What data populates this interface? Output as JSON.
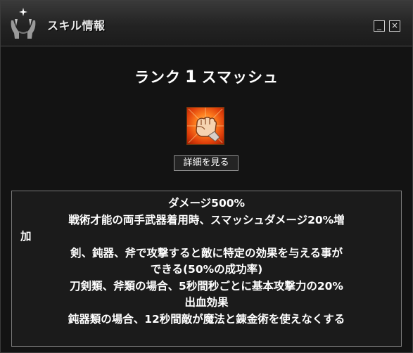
{
  "window": {
    "title": "スキル情報",
    "minimize_label": "_",
    "close_label": "×"
  },
  "skill": {
    "rank_prefix": "ランク",
    "rank_number": "1",
    "name": "スマッシュ",
    "icon": "fist-icon",
    "detail_button_label": "詳細を見る"
  },
  "description": {
    "lines": [
      "ダメージ500%",
      "戦術才能の両手武器着用時、スマッシュダメージ20%増",
      "加",
      "剣、鈍器、斧で攻撃すると敵に特定の効果を与える事が",
      "できる(50%の成功率)",
      "刀剣類、斧類の場合、5秒間秒ごとに基本攻撃力の20%",
      "出血効果",
      "鈍器類の場合、12秒間敵が魔法と錬金術を使えなくする"
    ]
  }
}
